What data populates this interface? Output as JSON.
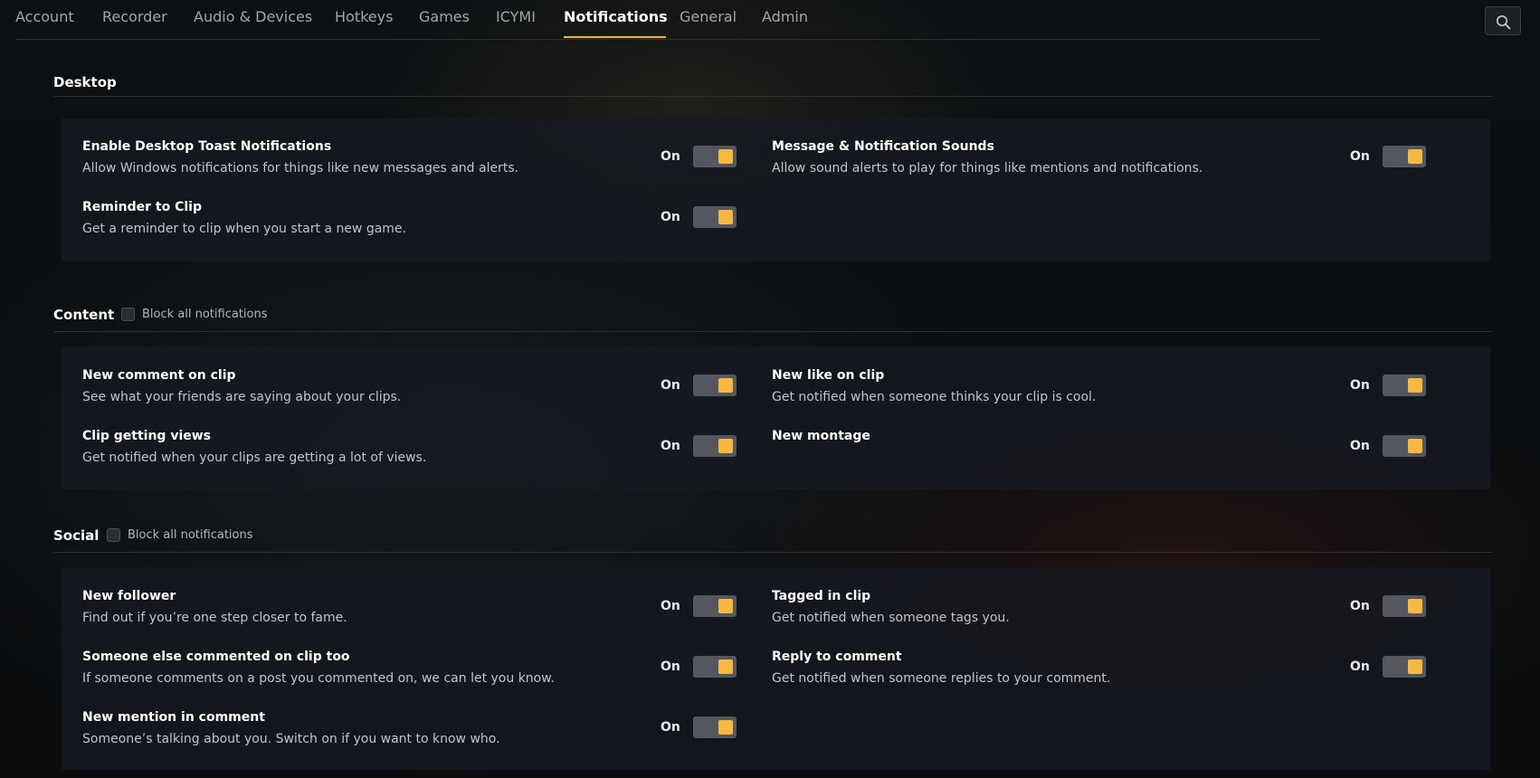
{
  "nav": {
    "tabs": [
      {
        "label": "Account"
      },
      {
        "label": "Recorder"
      },
      {
        "label": "Audio & Devices"
      },
      {
        "label": "Hotkeys"
      },
      {
        "label": "Games"
      },
      {
        "label": "ICYMI"
      },
      {
        "label": "Notifications",
        "active": true
      },
      {
        "label": "General"
      },
      {
        "label": "Admin"
      }
    ],
    "search_icon": "search-icon"
  },
  "accent_color": "#f5b842",
  "sections": {
    "desktop": {
      "title": "Desktop",
      "settings": [
        {
          "title": "Enable Desktop Toast Notifications",
          "desc": "Allow Windows notifications for things like new messages and alerts.",
          "state": "On"
        },
        {
          "title": "Message & Notification Sounds",
          "desc": "Allow sound alerts to play for things like mentions and notifications.",
          "state": "On"
        },
        {
          "title": "Reminder to Clip",
          "desc": "Get a reminder to clip when you start a new game.",
          "state": "On"
        }
      ]
    },
    "content": {
      "title": "Content",
      "block_all_label": "Block all notifications",
      "block_all_checked": false,
      "settings": [
        {
          "title": "New comment on clip",
          "desc": "See what your friends are saying about your clips.",
          "state": "On"
        },
        {
          "title": "New like on clip",
          "desc": "Get notified when someone thinks your clip is cool.",
          "state": "On"
        },
        {
          "title": "Clip getting views",
          "desc": "Get notified when your clips are getting a lot of views.",
          "state": "On"
        },
        {
          "title": "New montage",
          "desc": "",
          "state": "On"
        }
      ]
    },
    "social": {
      "title": "Social",
      "block_all_label": "Block all notifications",
      "block_all_checked": false,
      "settings": [
        {
          "title": "New follower",
          "desc": "Find out if you’re one step closer to fame.",
          "state": "On"
        },
        {
          "title": "Tagged in clip",
          "desc": "Get notified when someone tags you.",
          "state": "On"
        },
        {
          "title": "Someone else commented on clip too",
          "desc": "If someone comments on a post you commented on, we can let you know.",
          "state": "On"
        },
        {
          "title": "Reply to comment",
          "desc": "Get notified when someone replies to your comment.",
          "state": "On"
        },
        {
          "title": "New mention in comment",
          "desc": "Someone’s talking about you. Switch on if you want to know who.",
          "state": "On"
        }
      ]
    }
  }
}
